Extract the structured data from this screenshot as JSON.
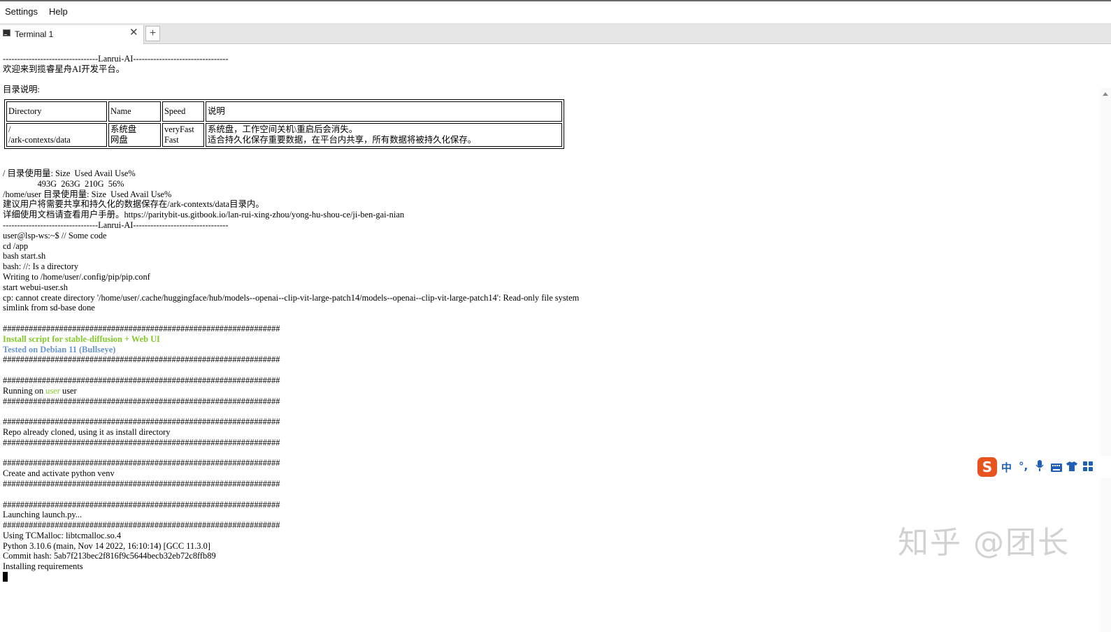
{
  "menubar": {
    "settings": "Settings",
    "help": "Help"
  },
  "tab": {
    "icon": "terminal-icon",
    "label": "Terminal 1",
    "close": "✕",
    "new_tab": "+"
  },
  "terminal": {
    "lines_top": [
      "---------------------------------Lanrui-AI---------------------------------",
      "欢迎来到揽睿星舟AI开发平台。",
      "",
      "目录说明:"
    ],
    "table": {
      "headers": [
        "Directory",
        "Name",
        "Speed",
        "说明"
      ],
      "rows": [
        [
          "/",
          "系统盘",
          "veryFast",
          "系统盘，工作空间关机\\重启后会消失。"
        ],
        [
          "/ark-contexts/data",
          "网盘",
          "Fast",
          "适合持久化保存重要数据，在平台内共享，所有数据将被持久化保存。"
        ]
      ]
    },
    "lines_mid": [
      "/ 目录使用量: Size  Used Avail Use%",
      "                493G  263G  210G  56%",
      "/home/user 目录使用量: Size  Used Avail Use%",
      "建议用户将需要共享和持久化的数据保存在/ark-contexts/data目录内。",
      "详细使用文档请查看用户手册。https://paritybit-us.gitbook.io/lan-rui-xing-zhou/yong-hu-shou-ce/ji-ben-gai-nian",
      "---------------------------------Lanrui-AI---------------------------------",
      "user@lsp-ws:~$ // Some code",
      "cd /app",
      "bash start.sh",
      "bash: //: Is a directory",
      "Writing to /home/user/.config/pip/pip.conf",
      "start webui-user.sh",
      "cp: cannot create directory '/home/user/.cache/huggingface/hub/models--openai--clip-vit-large-patch14/models--openai--clip-vit-large-patch14': Read-only file system",
      "simlink from sd-base done",
      "",
      "################################################################"
    ],
    "install_title": "Install script for stable-diffusion + Web UI",
    "tested_on": "Tested on Debian 11 (Bullseye)",
    "hashes": "################################################################",
    "running_prefix": "Running on ",
    "running_user_colored": "user",
    "running_suffix": " user",
    "repo_line": "Repo already cloned, using it as install directory",
    "venv_line": "Create and activate python venv",
    "launching_line": "Launching launch.py...",
    "lines_bottom": [
      "Using TCMalloc: libtcmalloc.so.4",
      "Python 3.10.6 (main, Nov 14 2022, 16:10:14) [GCC 11.3.0]",
      "Commit hash: 5ab7f213bec2f816f9c5644becb32eb72c8ffb89",
      "Installing requirements"
    ]
  },
  "ime": {
    "logo": "S",
    "chinese": "中",
    "punct": "°,",
    "mic_icon": "microphone-icon",
    "keyboard_icon": "keyboard-icon",
    "skin_icon": "shirt-icon",
    "grid_icon": "grid-icon"
  },
  "watermark": "知乎 @团长",
  "colors": {
    "install_green": "#84c92b",
    "tested_blue": "#6a95c8",
    "ime_orange": "#e8541e"
  }
}
